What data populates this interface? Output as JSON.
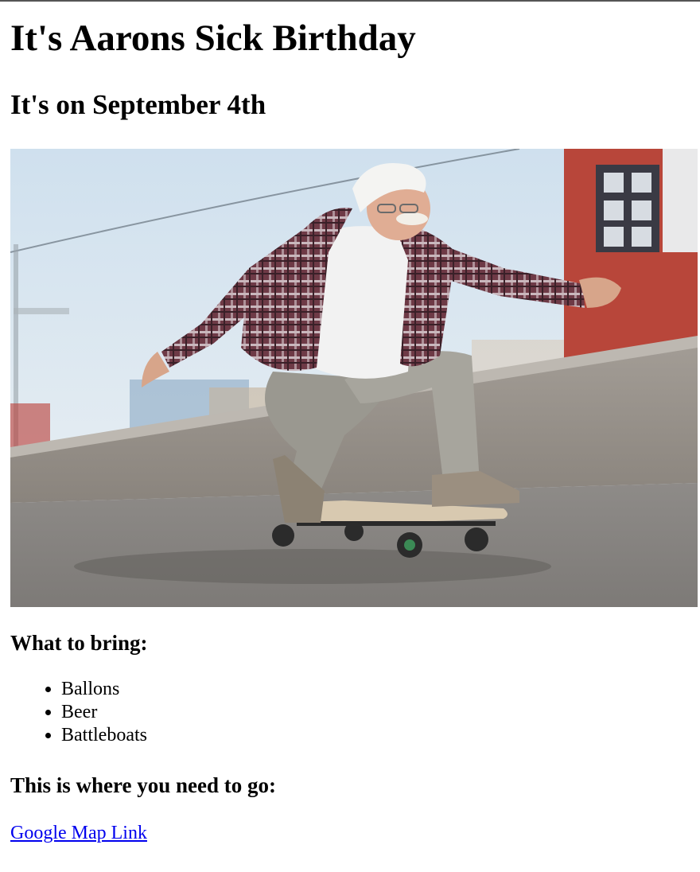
{
  "page": {
    "title": "It's Aarons Sick Birthday",
    "subtitle": "It's on September 4th"
  },
  "image": {
    "description_icon": "photo-elderly-man-skateboarding"
  },
  "bring": {
    "heading": "What to bring:",
    "items": [
      "Ballons",
      "Beer",
      "Battleboats"
    ]
  },
  "directions": {
    "heading": "This is where you need to go:",
    "link_label": "Google Map Link"
  },
  "colors": {
    "link": "#0000ee",
    "text": "#000000",
    "background": "#ffffff"
  }
}
